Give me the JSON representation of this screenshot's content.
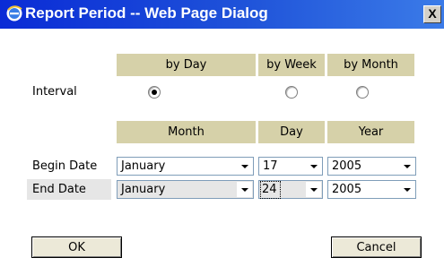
{
  "window": {
    "title": "Report Period -- Web Page Dialog",
    "close_label": "X"
  },
  "interval": {
    "label": "Interval",
    "options": [
      {
        "label": "by Day",
        "selected": true
      },
      {
        "label": "by Week",
        "selected": false
      },
      {
        "label": "by Month",
        "selected": false
      }
    ]
  },
  "dates": {
    "headers": {
      "month": "Month",
      "day": "Day",
      "year": "Year"
    },
    "begin": {
      "label": "Begin Date",
      "month": "January",
      "day": "17",
      "year": "2005"
    },
    "end": {
      "label": "End Date",
      "month": "January",
      "day": "24",
      "year": "2005"
    }
  },
  "buttons": {
    "ok": "OK",
    "cancel": "Cancel"
  },
  "colors": {
    "header_bg": "#d6d1a9",
    "titlebar": "#0a2bd6",
    "label_bg": "#e6e6e6"
  }
}
